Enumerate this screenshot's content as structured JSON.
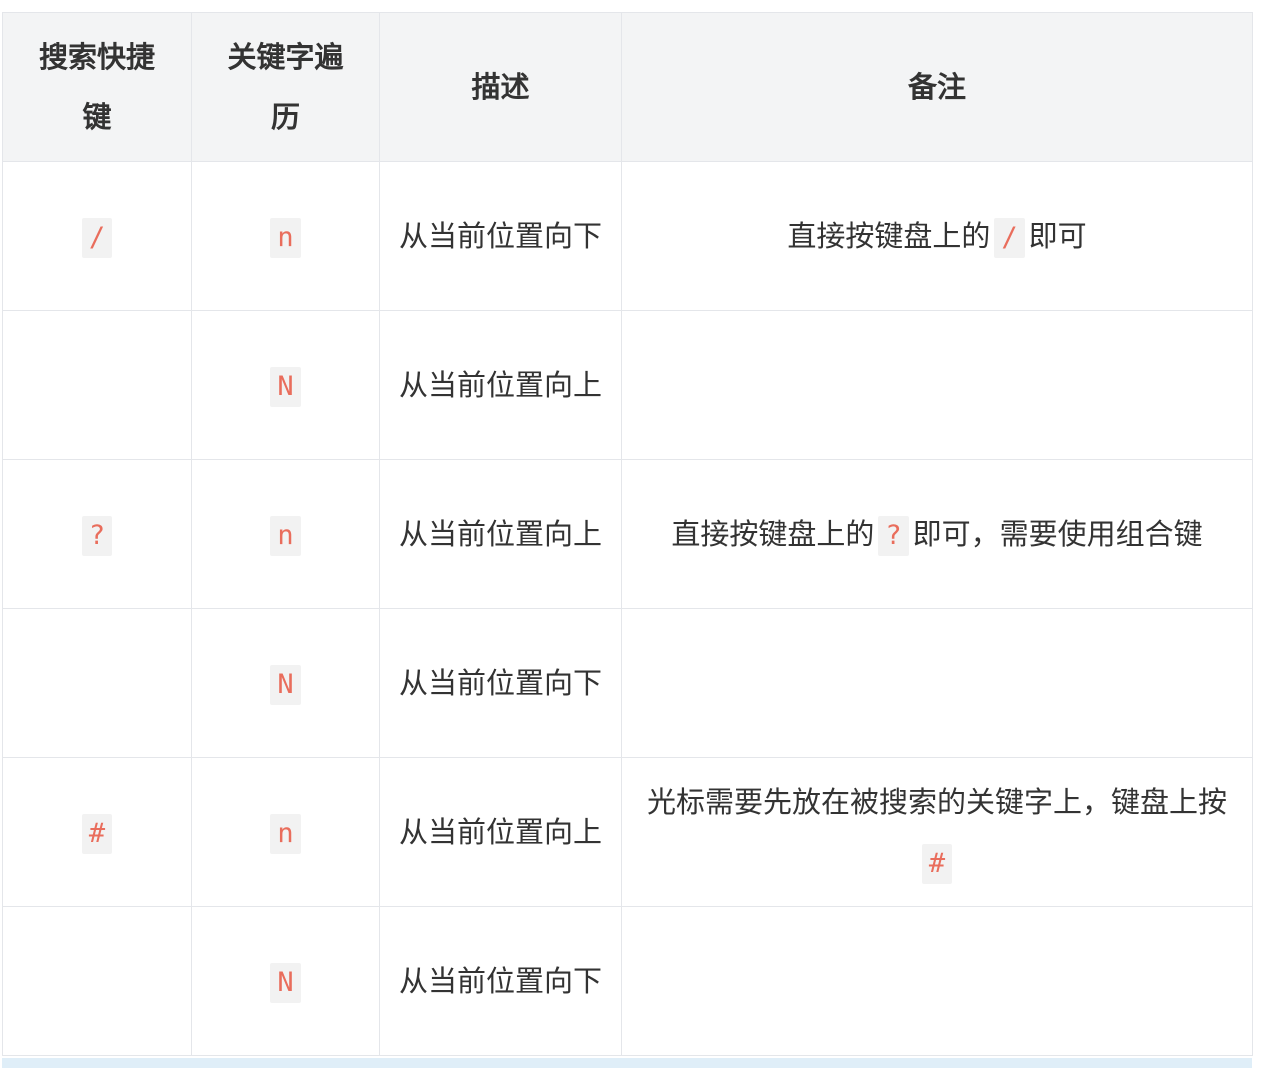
{
  "headers": {
    "shortcut": "搜索快捷键",
    "traverse": "关键字遍历",
    "description": "描述",
    "note": "备注"
  },
  "rows": [
    {
      "shortcut": "/",
      "traverse": "n",
      "description": "从当前位置向下",
      "note_before": "直接按键盘上的",
      "note_code": "/",
      "note_after": "即可"
    },
    {
      "shortcut": "",
      "traverse": "N",
      "description": "从当前位置向上",
      "note_before": "",
      "note_code": "",
      "note_after": ""
    },
    {
      "shortcut": "?",
      "traverse": "n",
      "description": "从当前位置向上",
      "note_before": "直接按键盘上的",
      "note_code": "?",
      "note_after": "即可，需要使用组合键"
    },
    {
      "shortcut": "",
      "traverse": "N",
      "description": "从当前位置向下",
      "note_before": "",
      "note_code": "",
      "note_after": ""
    },
    {
      "shortcut": "#",
      "traverse": "n",
      "description": "从当前位置向上",
      "note_before": "光标需要先放在被搜索的关键字上，键盘上按",
      "note_code": "#",
      "note_after": ""
    },
    {
      "shortcut": "",
      "traverse": "N",
      "description": "从当前位置向下",
      "note_before": "",
      "note_code": "",
      "note_after": ""
    }
  ],
  "colors": {
    "code_text": "#e96d5c",
    "code_background": "#f2f2f2",
    "header_background": "#f3f4f5",
    "border": "#e4e6ea"
  }
}
